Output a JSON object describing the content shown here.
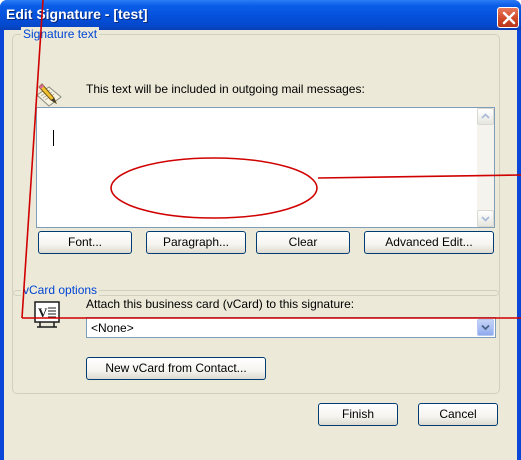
{
  "window": {
    "title": "Edit Signature - [test]"
  },
  "signature_group": {
    "legend": "Signature text",
    "info": "This text will be included in outgoing mail messages:",
    "text_value": ""
  },
  "buttons": {
    "font": "Font...",
    "paragraph": "Paragraph...",
    "clear": "Clear",
    "advanced_edit": "Advanced Edit..."
  },
  "vcard_group": {
    "legend": "vCard options",
    "attach_label": "Attach this business card (vCard) to this signature:",
    "selected_card": "<None>",
    "new_vcard_button": "New vCard from Contact..."
  },
  "footer": {
    "finish": "Finish",
    "cancel": "Cancel"
  },
  "icons": {
    "close": "close-icon",
    "signature": "pencil-paper-icon",
    "vcard": "vcard-icon",
    "scroll_up": "arrow-up-icon",
    "scroll_down": "arrow-down-icon",
    "dropdown": "chevron-down-icon"
  },
  "annotation": {
    "color": "#d00000"
  }
}
